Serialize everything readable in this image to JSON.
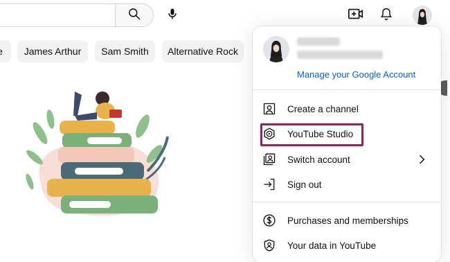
{
  "header": {
    "search_placeholder": "",
    "icons": [
      "search-icon",
      "mic-icon",
      "create-video-icon",
      "notifications-icon",
      "avatar"
    ]
  },
  "chips": [
    {
      "label": "e"
    },
    {
      "label": "James Arthur"
    },
    {
      "label": "Sam Smith"
    },
    {
      "label": "Alternative Rock"
    }
  ],
  "account_menu": {
    "manage_label": "Manage your Google Account",
    "items": [
      {
        "label": "Create a channel",
        "icon": "person-box-icon"
      },
      {
        "label": "YouTube Studio",
        "icon": "studio-icon",
        "highlighted": true
      },
      {
        "label": "Switch account",
        "icon": "switch-account-icon",
        "has_submenu": true
      },
      {
        "label": "Sign out",
        "icon": "sign-out-icon"
      },
      {
        "label": "Purchases and memberships",
        "icon": "dollar-icon"
      },
      {
        "label": "Your data in YouTube",
        "icon": "shield-person-icon"
      }
    ]
  },
  "colors": {
    "link": "#065fd4",
    "highlight_border": "#7c2f5c",
    "chip_bg": "#f2f2f2"
  }
}
